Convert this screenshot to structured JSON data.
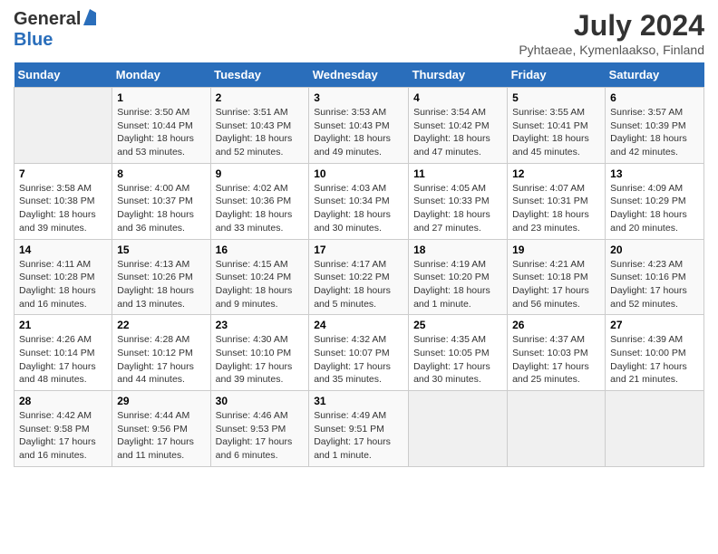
{
  "header": {
    "logo_general": "General",
    "logo_blue": "Blue",
    "title": "July 2024",
    "location": "Pyhtaeae, Kymenlaakso, Finland"
  },
  "days_of_week": [
    "Sunday",
    "Monday",
    "Tuesday",
    "Wednesday",
    "Thursday",
    "Friday",
    "Saturday"
  ],
  "weeks": [
    [
      {
        "day": "",
        "empty": true
      },
      {
        "day": "1",
        "sunrise": "3:50 AM",
        "sunset": "10:44 PM",
        "daylight": "18 hours and 53 minutes."
      },
      {
        "day": "2",
        "sunrise": "3:51 AM",
        "sunset": "10:43 PM",
        "daylight": "18 hours and 52 minutes."
      },
      {
        "day": "3",
        "sunrise": "3:53 AM",
        "sunset": "10:43 PM",
        "daylight": "18 hours and 49 minutes."
      },
      {
        "day": "4",
        "sunrise": "3:54 AM",
        "sunset": "10:42 PM",
        "daylight": "18 hours and 47 minutes."
      },
      {
        "day": "5",
        "sunrise": "3:55 AM",
        "sunset": "10:41 PM",
        "daylight": "18 hours and 45 minutes."
      },
      {
        "day": "6",
        "sunrise": "3:57 AM",
        "sunset": "10:39 PM",
        "daylight": "18 hours and 42 minutes."
      }
    ],
    [
      {
        "day": "7",
        "sunrise": "3:58 AM",
        "sunset": "10:38 PM",
        "daylight": "18 hours and 39 minutes."
      },
      {
        "day": "8",
        "sunrise": "4:00 AM",
        "sunset": "10:37 PM",
        "daylight": "18 hours and 36 minutes."
      },
      {
        "day": "9",
        "sunrise": "4:02 AM",
        "sunset": "10:36 PM",
        "daylight": "18 hours and 33 minutes."
      },
      {
        "day": "10",
        "sunrise": "4:03 AM",
        "sunset": "10:34 PM",
        "daylight": "18 hours and 30 minutes."
      },
      {
        "day": "11",
        "sunrise": "4:05 AM",
        "sunset": "10:33 PM",
        "daylight": "18 hours and 27 minutes."
      },
      {
        "day": "12",
        "sunrise": "4:07 AM",
        "sunset": "10:31 PM",
        "daylight": "18 hours and 23 minutes."
      },
      {
        "day": "13",
        "sunrise": "4:09 AM",
        "sunset": "10:29 PM",
        "daylight": "18 hours and 20 minutes."
      }
    ],
    [
      {
        "day": "14",
        "sunrise": "4:11 AM",
        "sunset": "10:28 PM",
        "daylight": "18 hours and 16 minutes."
      },
      {
        "day": "15",
        "sunrise": "4:13 AM",
        "sunset": "10:26 PM",
        "daylight": "18 hours and 13 minutes."
      },
      {
        "day": "16",
        "sunrise": "4:15 AM",
        "sunset": "10:24 PM",
        "daylight": "18 hours and 9 minutes."
      },
      {
        "day": "17",
        "sunrise": "4:17 AM",
        "sunset": "10:22 PM",
        "daylight": "18 hours and 5 minutes."
      },
      {
        "day": "18",
        "sunrise": "4:19 AM",
        "sunset": "10:20 PM",
        "daylight": "18 hours and 1 minute."
      },
      {
        "day": "19",
        "sunrise": "4:21 AM",
        "sunset": "10:18 PM",
        "daylight": "17 hours and 56 minutes."
      },
      {
        "day": "20",
        "sunrise": "4:23 AM",
        "sunset": "10:16 PM",
        "daylight": "17 hours and 52 minutes."
      }
    ],
    [
      {
        "day": "21",
        "sunrise": "4:26 AM",
        "sunset": "10:14 PM",
        "daylight": "17 hours and 48 minutes."
      },
      {
        "day": "22",
        "sunrise": "4:28 AM",
        "sunset": "10:12 PM",
        "daylight": "17 hours and 44 minutes."
      },
      {
        "day": "23",
        "sunrise": "4:30 AM",
        "sunset": "10:10 PM",
        "daylight": "17 hours and 39 minutes."
      },
      {
        "day": "24",
        "sunrise": "4:32 AM",
        "sunset": "10:07 PM",
        "daylight": "17 hours and 35 minutes."
      },
      {
        "day": "25",
        "sunrise": "4:35 AM",
        "sunset": "10:05 PM",
        "daylight": "17 hours and 30 minutes."
      },
      {
        "day": "26",
        "sunrise": "4:37 AM",
        "sunset": "10:03 PM",
        "daylight": "17 hours and 25 minutes."
      },
      {
        "day": "27",
        "sunrise": "4:39 AM",
        "sunset": "10:00 PM",
        "daylight": "17 hours and 21 minutes."
      }
    ],
    [
      {
        "day": "28",
        "sunrise": "4:42 AM",
        "sunset": "9:58 PM",
        "daylight": "17 hours and 16 minutes."
      },
      {
        "day": "29",
        "sunrise": "4:44 AM",
        "sunset": "9:56 PM",
        "daylight": "17 hours and 11 minutes."
      },
      {
        "day": "30",
        "sunrise": "4:46 AM",
        "sunset": "9:53 PM",
        "daylight": "17 hours and 6 minutes."
      },
      {
        "day": "31",
        "sunrise": "4:49 AM",
        "sunset": "9:51 PM",
        "daylight": "17 hours and 1 minute."
      },
      {
        "day": "",
        "empty": true
      },
      {
        "day": "",
        "empty": true
      },
      {
        "day": "",
        "empty": true
      }
    ]
  ],
  "cell_labels": {
    "sunrise": "Sunrise:",
    "sunset": "Sunset:",
    "daylight": "Daylight:"
  }
}
